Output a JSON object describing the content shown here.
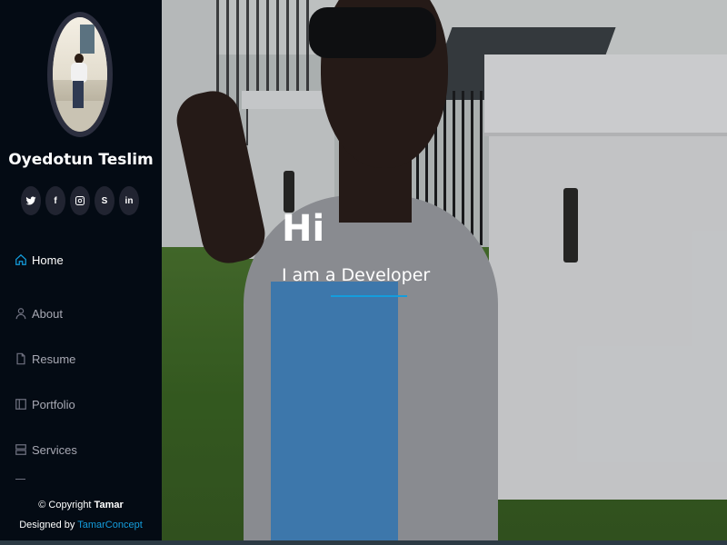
{
  "profile": {
    "name": "Oyedotun Teslim"
  },
  "social": [
    {
      "name": "twitter",
      "glyph": "twitter-icon"
    },
    {
      "name": "facebook",
      "glyph": "facebook-icon",
      "label": "f"
    },
    {
      "name": "instagram",
      "glyph": "instagram-icon"
    },
    {
      "name": "skype",
      "glyph": "skype-icon",
      "label": "S"
    },
    {
      "name": "linkedin",
      "glyph": "linkedin-icon",
      "label": "in"
    }
  ],
  "nav": {
    "items": [
      {
        "label": "Home",
        "icon": "home-icon",
        "active": true
      },
      {
        "label": "About",
        "icon": "person-icon",
        "active": false
      },
      {
        "label": "Resume",
        "icon": "file-icon",
        "active": false
      },
      {
        "label": "Portfolio",
        "icon": "book-icon",
        "active": false
      },
      {
        "label": "Services",
        "icon": "server-icon",
        "active": false
      }
    ]
  },
  "footer": {
    "copyright_prefix": "© Copyright ",
    "copyright_name": "Tamar",
    "designed_prefix": "Designed by ",
    "designed_link": "TamarConcept"
  },
  "hero": {
    "title": "Hi",
    "subtitle": "I am a Developer"
  },
  "colors": {
    "sidebar_bg": "#040b14",
    "accent": "#149ddd",
    "social_bg": "#212431"
  }
}
